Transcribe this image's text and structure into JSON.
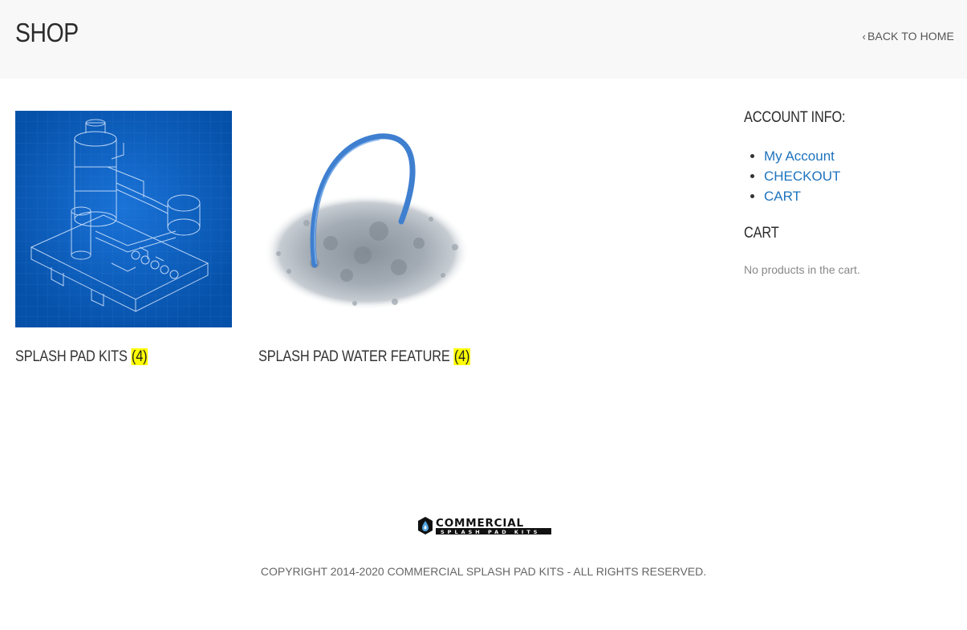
{
  "header": {
    "title": "SHOP",
    "back_link": "BACK TO HOME",
    "back_icon": "chevron-left-icon"
  },
  "categories": [
    {
      "name": "SPLASH PAD KITS",
      "count": "(4)",
      "image": "blueprint-kit-image"
    },
    {
      "name": "SPLASH PAD WATER FEATURE",
      "count": "(4)",
      "image": "water-arch-feature-image"
    }
  ],
  "sidebar": {
    "account_title": "ACCOUNT INFO:",
    "account_links": [
      "My Account",
      "CHECKOUT",
      "CART"
    ],
    "cart_title": "CART",
    "cart_empty": "No products in the cart."
  },
  "footer": {
    "logo_text_main": "COMMERCIAL",
    "logo_text_sub": "SPLASH PAD KITS",
    "copyright": "COPYRIGHT 2014-2020 COMMERCIAL SPLASH PAD KITS - ALL RIGHTS RESERVED."
  },
  "colors": {
    "header_bg": "#f8f8f8",
    "link": "#1e73be",
    "count_highlight": "#ffff00",
    "blueprint": "#0a5ab8"
  }
}
